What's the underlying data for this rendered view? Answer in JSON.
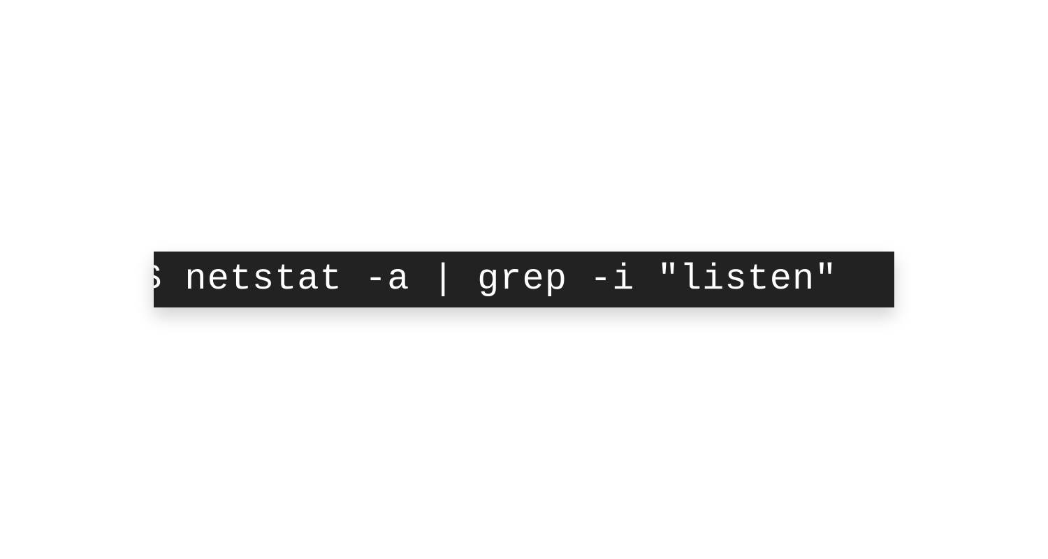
{
  "terminal": {
    "command": "$ netstat -a | grep -i \"listen\""
  },
  "colors": {
    "background": "#222222",
    "foreground": "#ffffff"
  }
}
